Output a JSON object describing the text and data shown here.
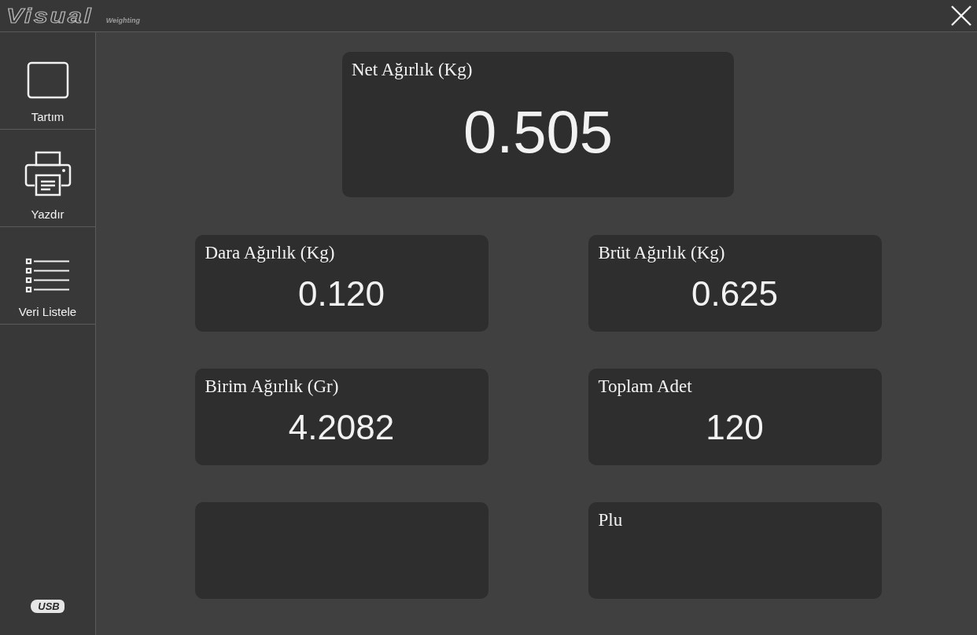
{
  "header": {
    "logo": "Visual",
    "logo_sub": "Weighting"
  },
  "sidebar": {
    "items": [
      {
        "label": "Tartım",
        "kind": "square"
      },
      {
        "label": "Yazdır",
        "kind": "printer"
      },
      {
        "label": "Veri Listele",
        "kind": "list"
      }
    ],
    "usb": "USB"
  },
  "net": {
    "label": "Net Ağırlık (Kg)",
    "value": "0.505"
  },
  "cards": [
    {
      "kind": "reading",
      "label": "Dara Ağırlık (Kg)",
      "value": "0.120"
    },
    {
      "kind": "reading",
      "label": "Brüt Ağırlık (Kg)",
      "value": "0.625"
    },
    {
      "kind": "reading",
      "label": "Birim Ağırlık (Gr)",
      "value": "4.2082"
    },
    {
      "kind": "reading",
      "label": "Toplam Adet",
      "value": "120"
    },
    {
      "kind": "blank"
    },
    {
      "kind": "reading",
      "label": "Plu"
    }
  ]
}
